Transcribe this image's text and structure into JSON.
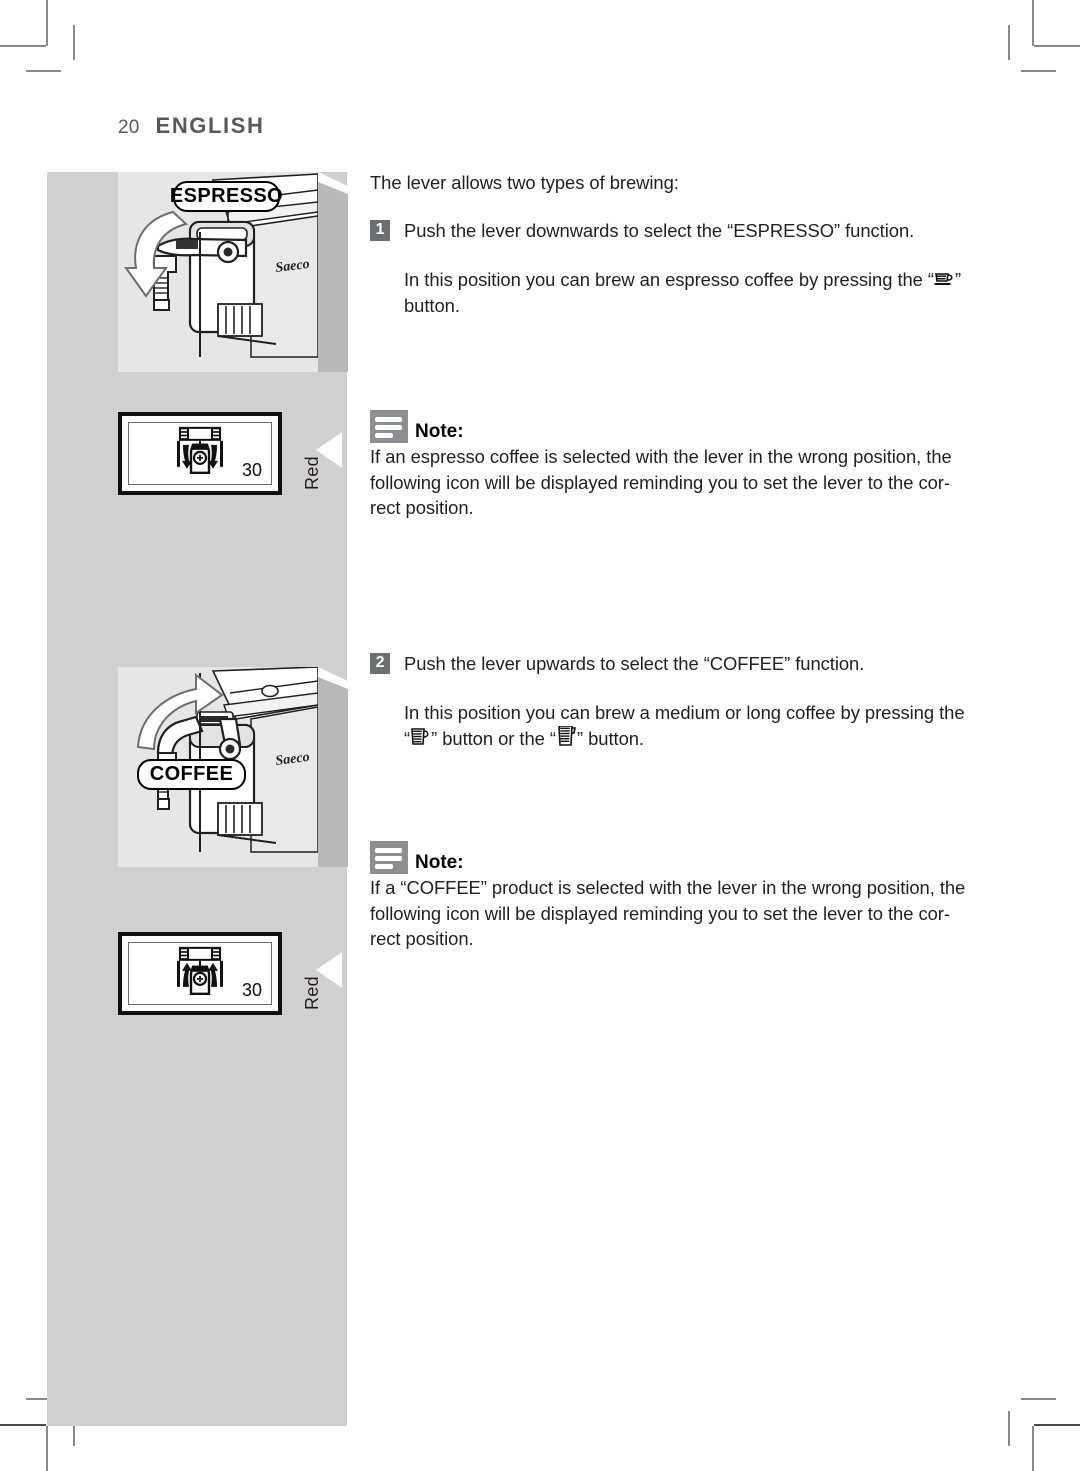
{
  "page": {
    "number": "20",
    "language_title": "ENGLISH"
  },
  "colors": {
    "band_gray": "#d0d0d0",
    "illustration_gray": "#e6e6e6",
    "step_badge_gray": "#6d6e71",
    "note_icon_gray": "#8e8f92",
    "header_gray": "#58595b",
    "text_black": "#231f20"
  },
  "content": {
    "intro": "The lever allows two types of brewing:",
    "steps": [
      {
        "number": "1",
        "text": "Push the lever downwards to select the “ESPRESSO” function.",
        "detail_before": "In this position you can brew an espresso coffee by pressing the “",
        "detail_after": "” button.",
        "detail_icons": [
          "espresso-cup-button-icon"
        ]
      },
      {
        "number": "2",
        "text": "Push the lever upwards to select the “COFFEE” function.",
        "detail_before": "In this position you can brew a medium or long coffee by pressing the “",
        "detail_middle": "” button or the “",
        "detail_after": "” button.",
        "detail_icons": [
          "medium-coffee-button-icon",
          "long-coffee-button-icon"
        ]
      }
    ],
    "notes": [
      {
        "icon": "note-icon",
        "title": "Note:",
        "body": "If an espresso coffee is selected with the lever in the wrong position, the following icon will be displayed reminding you to set the lever to the cor-rect position."
      },
      {
        "icon": "note-icon",
        "title": "Note:",
        "body": "If a “COFFEE” product is selected with the lever in the wrong position, the following icon will be displayed reminding you to set the lever to the cor-rect position."
      }
    ]
  },
  "illustrations": [
    {
      "name": "espresso-lever-position-illustration",
      "badge_label": "ESPRESSO",
      "arrow_direction": "down",
      "brand_text": "Saeco"
    },
    {
      "name": "coffee-lever-position-illustration",
      "badge_label": "COFFEE",
      "arrow_direction": "up",
      "brand_text": "Saeco"
    }
  ],
  "displays": [
    {
      "name": "espresso-wrong-lever-display",
      "number": "30",
      "pointer_label": "Red",
      "glyph": "lever-down-warning-icon"
    },
    {
      "name": "coffee-wrong-lever-display",
      "number": "30",
      "pointer_label": "Red",
      "glyph": "lever-up-warning-icon"
    }
  ]
}
